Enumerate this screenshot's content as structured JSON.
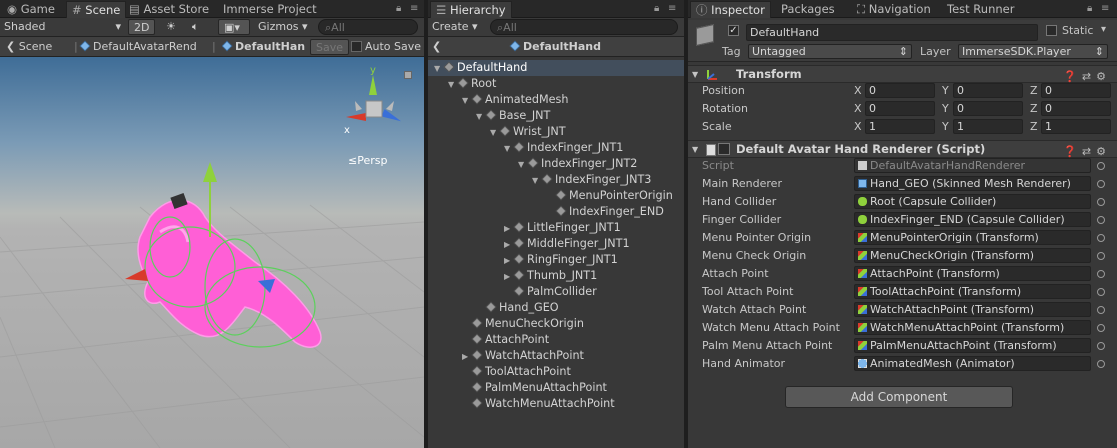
{
  "scene_panel": {
    "tabs": [
      "Game",
      "Scene",
      "Asset Store",
      "Immerse Project"
    ],
    "toolbar": {
      "shading": "Shaded",
      "mode_2d": "2D",
      "gizmos": "Gizmos",
      "search_placeholder": "All"
    },
    "breadcrumb": [
      "Scene",
      "DefaultAvatarRend",
      "DefaultHan"
    ],
    "save_label": "Save",
    "auto_save_label": "Auto Save",
    "persp_label": "Persp",
    "axis_y": "y",
    "axis_x": "x"
  },
  "hierarchy": {
    "tab": "Hierarchy",
    "create_label": "Create",
    "search_placeholder": "All",
    "prefab_title": "DefaultHand",
    "rows": [
      {
        "label": "DefaultHand",
        "depth": 0,
        "arrow": "open"
      },
      {
        "label": "Root",
        "depth": 1,
        "arrow": "open"
      },
      {
        "label": "AnimatedMesh",
        "depth": 2,
        "arrow": "open"
      },
      {
        "label": "Base_JNT",
        "depth": 3,
        "arrow": "open"
      },
      {
        "label": "Wrist_JNT",
        "depth": 4,
        "arrow": "open"
      },
      {
        "label": "IndexFinger_JNT1",
        "depth": 5,
        "arrow": "open"
      },
      {
        "label": "IndexFinger_JNT2",
        "depth": 6,
        "arrow": "open"
      },
      {
        "label": "IndexFinger_JNT3",
        "depth": 7,
        "arrow": "open"
      },
      {
        "label": "MenuPointerOrigin",
        "depth": 8,
        "arrow": "none"
      },
      {
        "label": "IndexFinger_END",
        "depth": 8,
        "arrow": "none"
      },
      {
        "label": "LittleFinger_JNT1",
        "depth": 5,
        "arrow": "closed"
      },
      {
        "label": "MiddleFinger_JNT1",
        "depth": 5,
        "arrow": "closed"
      },
      {
        "label": "RingFinger_JNT1",
        "depth": 5,
        "arrow": "closed"
      },
      {
        "label": "Thumb_JNT1",
        "depth": 5,
        "arrow": "closed"
      },
      {
        "label": "PalmCollider",
        "depth": 5,
        "arrow": "none"
      },
      {
        "label": "Hand_GEO",
        "depth": 3,
        "arrow": "none"
      },
      {
        "label": "MenuCheckOrigin",
        "depth": 2,
        "arrow": "none"
      },
      {
        "label": "AttachPoint",
        "depth": 2,
        "arrow": "none"
      },
      {
        "label": "WatchAttachPoint",
        "depth": 2,
        "arrow": "closed"
      },
      {
        "label": "ToolAttachPoint",
        "depth": 2,
        "arrow": "none"
      },
      {
        "label": "PalmMenuAttachPoint",
        "depth": 2,
        "arrow": "none"
      },
      {
        "label": "WatchMenuAttachPoint",
        "depth": 2,
        "arrow": "none"
      }
    ]
  },
  "inspector": {
    "tabs": [
      "Inspector",
      "Packages",
      "Navigation",
      "Test Runner"
    ],
    "object_name": "DefaultHand",
    "static_label": "Static",
    "tag_label": "Tag",
    "tag_value": "Untagged",
    "layer_label": "Layer",
    "layer_value": "ImmerseSDK.Player",
    "transform": {
      "title": "Transform",
      "rows": [
        {
          "label": "Position",
          "x": "0",
          "y": "0",
          "z": "0"
        },
        {
          "label": "Rotation",
          "x": "0",
          "y": "0",
          "z": "0"
        },
        {
          "label": "Scale",
          "x": "1",
          "y": "1",
          "z": "1"
        }
      ],
      "axis_labels": [
        "X",
        "Y",
        "Z"
      ]
    },
    "script_component": {
      "title": "Default Avatar Hand Renderer (Script)",
      "script_label": "Script",
      "script_value": "DefaultAvatarHandRenderer",
      "fields": [
        {
          "label": "Main Renderer",
          "value": "Hand_GEO (Skinned Mesh Renderer)",
          "icon": "mesh-renderer-icon"
        },
        {
          "label": "Hand Collider",
          "value": "Root (Capsule Collider)",
          "icon": "capsule-collider-icon"
        },
        {
          "label": "Finger Collider",
          "value": "IndexFinger_END (Capsule Collider)",
          "icon": "capsule-collider-icon"
        },
        {
          "label": "Menu Pointer Origin",
          "value": "MenuPointerOrigin (Transform)",
          "icon": "transform-icon"
        },
        {
          "label": "Menu Check Origin",
          "value": "MenuCheckOrigin (Transform)",
          "icon": "transform-icon"
        },
        {
          "label": "Attach Point",
          "value": "AttachPoint (Transform)",
          "icon": "transform-icon"
        },
        {
          "label": "Tool Attach Point",
          "value": "ToolAttachPoint (Transform)",
          "icon": "transform-icon"
        },
        {
          "label": "Watch Attach Point",
          "value": "WatchAttachPoint (Transform)",
          "icon": "transform-icon"
        },
        {
          "label": "Watch Menu Attach Point",
          "value": "WatchMenuAttachPoint (Transform)",
          "icon": "transform-icon"
        },
        {
          "label": "Palm Menu Attach Point",
          "value": "PalmMenuAttachPoint (Transform)",
          "icon": "transform-icon"
        },
        {
          "label": "Hand Animator",
          "value": "AnimatedMesh (Animator)",
          "icon": "animator-icon"
        }
      ]
    },
    "add_component_label": "Add Component"
  },
  "colors": {
    "selection": "#424e5c",
    "hand_mesh": "#ff5fd6",
    "gizmo_y": "#8fd13c",
    "gizmo_x": "#d83a2a",
    "gizmo_z": "#3a6fd8"
  }
}
